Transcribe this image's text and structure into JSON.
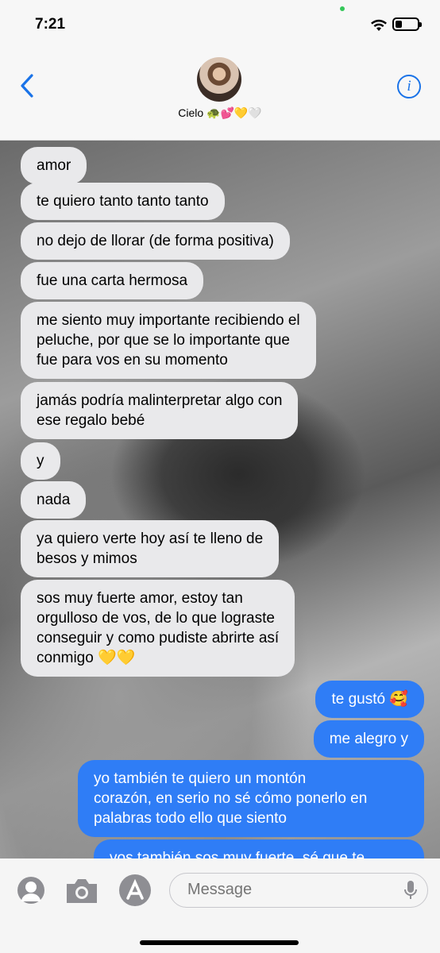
{
  "status": {
    "time": "7:21",
    "battery_level": 0.3
  },
  "contact": {
    "name": "Cielo 🐢💕💛🤍"
  },
  "messages": [
    {
      "dir": "in",
      "text": "amor"
    },
    {
      "dir": "in",
      "text": "te quiero tanto tanto tanto"
    },
    {
      "dir": "in",
      "text": "no dejo de llorar (de forma positiva)"
    },
    {
      "dir": "in",
      "text": "fue una carta hermosa"
    },
    {
      "dir": "in",
      "text": "me siento muy importante recibiendo el\npeluche, por que se lo importante que\nfue para vos en su momento"
    },
    {
      "dir": "in",
      "text": "jamás podría malinterpretar algo con\nese regalo bebé"
    },
    {
      "dir": "in",
      "text": "y"
    },
    {
      "dir": "in",
      "text": "nada"
    },
    {
      "dir": "in",
      "text": "ya quiero verte hoy así te lleno de\nbesos y mimos"
    },
    {
      "dir": "in",
      "text": "sos muy fuerte amor, estoy tan\norgulloso de vos, de lo que lograste\nconseguir y como pudiste abrirte así\nconmigo 💛💛"
    },
    {
      "dir": "out",
      "text": "te gustó 🥰"
    },
    {
      "dir": "out",
      "text": "me alegro y"
    },
    {
      "dir": "out",
      "text": "yo también te quiero un montón\ncorazón, en serio no sé cómo ponerlo en\npalabras todo ello que siento"
    },
    {
      "dir": "out",
      "text": "vos también sos muy fuerte, sé que te"
    }
  ],
  "composer": {
    "placeholder": "Message"
  },
  "icons": {
    "back": "chevron-left-icon",
    "info": "info-icon",
    "memoji": "memoji-icon",
    "camera": "camera-icon",
    "appstore": "app-store-icon",
    "mic": "microphone-icon"
  },
  "colors": {
    "accent": "#2f7df6",
    "incoming": "#e9e9eb"
  }
}
